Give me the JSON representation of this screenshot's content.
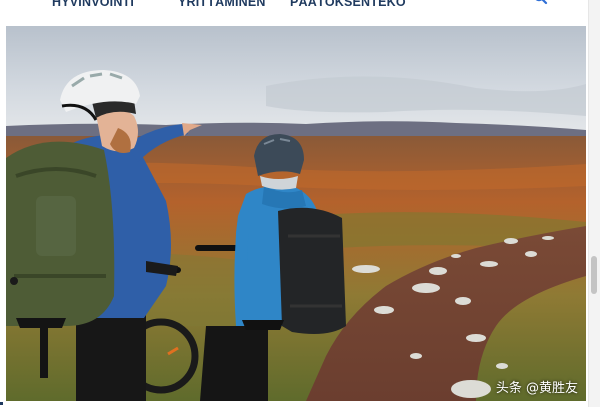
{
  "nav": {
    "items": [
      "HYVINVOINTI",
      "YRITTÄMINEN",
      "PÄÄTÖKSENTEKO"
    ],
    "search_icon": "search-icon",
    "color": "#1f3a5f"
  },
  "hero_image": {
    "watermark": "头条 @黄胜友"
  },
  "colors": {
    "jacket_blue": "#2f5fa8",
    "jacket_light_blue": "#2f86c7",
    "moorland_orange": "#b4622c",
    "sky": "#cfd6df"
  }
}
